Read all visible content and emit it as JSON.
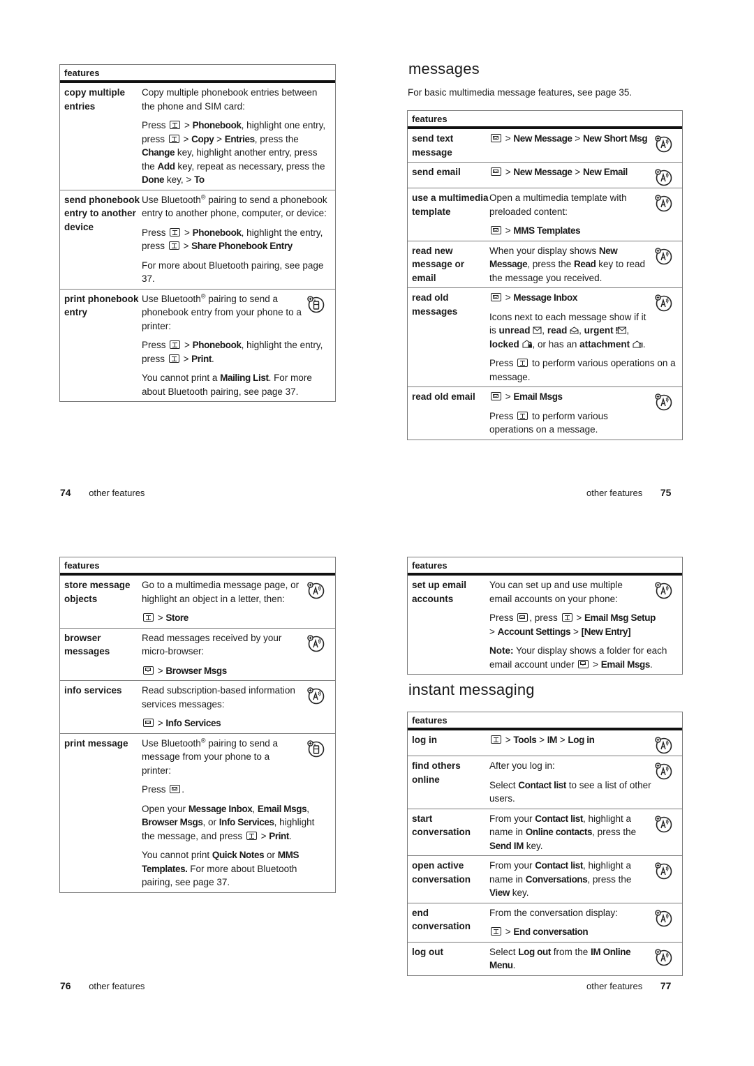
{
  "page74": {
    "table_header": "features",
    "rows": [
      {
        "name": "copy multiple entries",
        "intro": "Copy multiple phonebook entries between the phone and SIM card:",
        "steps": {
          "press": "Press",
          "phonebook": "Phonebook",
          "hl_one": ", highlight one entry,",
          "press2": "press",
          "copy": "Copy",
          "entries": "Entries",
          "press_the": ", press the",
          "change": "Change",
          "hl_another": "key, highlight another entry, press the",
          "add": "Add",
          "repeat": "key, repeat as necessary, press the",
          "done": "Done",
          "key": "key,",
          "to": "To"
        }
      },
      {
        "name": "send phonebook entry to another device",
        "intro_a": "Use Bluetooth",
        "intro_b": "pairing to send a phonebook entry to another phone, computer, or device:",
        "press": "Press",
        "phonebook": "Phonebook",
        "hl": ", highlight the entry,",
        "press2": "press",
        "share": "Share Phonebook Entry",
        "more": "For more about Bluetooth pairing, see page 37."
      },
      {
        "name": "print phonebook entry",
        "icon": "bluetooth-print-icon",
        "intro_a": "Use Bluetooth",
        "intro_b": "pairing to send a phonebook entry from your phone to a printer:",
        "press": "Press",
        "phonebook": "Phonebook",
        "hl": ", highlight the entry,",
        "press2": "press",
        "print": "Print",
        "cannot": "You cannot print a",
        "mailing": "Mailing List",
        "more": ". For more about Bluetooth pairing, see page 37."
      }
    ],
    "footer": {
      "number": "74",
      "label": "other features"
    }
  },
  "page75": {
    "title": "messages",
    "intro": "For basic multimedia message features, see page 35.",
    "table_header": "features",
    "rows": [
      {
        "name": "send text message",
        "path": [
          "New Message",
          "New Short Msg"
        ],
        "icon": "network-dependent-icon"
      },
      {
        "name": "send email",
        "path": [
          "New Message",
          "New Email"
        ],
        "icon": "network-dependent-icon"
      },
      {
        "name": "use a multimedia template",
        "intro": "Open a multimedia template with preloaded content:",
        "path": [
          "MMS Templates"
        ],
        "icon": "network-dependent-icon"
      },
      {
        "name": "read new message or email",
        "t1": "When your display shows",
        "b1": "New Message",
        "t2": ", press the",
        "b2": "Read",
        "t3": "key to read the message you received.",
        "icon": "network-dependent-icon"
      },
      {
        "name": "read old messages",
        "path": [
          "Message Inbox"
        ],
        "icons_text": {
          "a": "Icons next to each message show if it is",
          "unread": "unread",
          "read": "read",
          "urgent": "urgent",
          "locked": "locked",
          "b": ", or has an",
          "attachment": "attachment"
        },
        "press": "Press",
        "press_rest": "to perform various operations on a message.",
        "icon": "network-dependent-icon"
      },
      {
        "name": "read old email",
        "path": [
          "Email Msgs"
        ],
        "press": "Press",
        "press_rest": "to perform various operations on a message.",
        "icon": "network-dependent-icon"
      }
    ],
    "footer": {
      "number": "75",
      "label": "other features"
    }
  },
  "page76": {
    "table_header": "features",
    "rows": [
      {
        "name": "store message objects",
        "intro": "Go to a multimedia message page, or highlight an object in a letter, then:",
        "path": [
          "Store"
        ],
        "icon": "network-dependent-icon"
      },
      {
        "name": "browser messages",
        "intro": "Read messages received by your micro-browser:",
        "path": [
          "Browser Msgs"
        ],
        "icon": "network-dependent-icon"
      },
      {
        "name": "info services",
        "intro": "Read subscription-based information services messages:",
        "path": [
          "Info Services"
        ],
        "icon": "network-dependent-icon"
      },
      {
        "name": "print message",
        "icon": "bluetooth-print-icon",
        "intro_a": "Use Bluetooth",
        "intro_b": "pairing to send a message from your phone to a printer:",
        "press": "Press",
        "open": "Open your",
        "inbox": "Message Inbox",
        "email": "Email Msgs",
        "browser": "Browser Msgs",
        "or": ", or",
        "info": "Info Services",
        "hl": ", highlight the message, and press",
        "print": "Print",
        "cannot": "You cannot print",
        "quick": "Quick Notes",
        "or2": "or",
        "mms": "MMS Templates.",
        "more": "For more about Bluetooth pairing, see page 37."
      }
    ],
    "footer": {
      "number": "76",
      "label": "other features"
    }
  },
  "page77": {
    "table1_header": "features",
    "rows1": [
      {
        "name": "set up email accounts",
        "intro": "You can set up and use multiple email accounts on your phone:",
        "press": "Press",
        "press2": ", press",
        "setup": "Email Msg Setup",
        "account": "Account Settings",
        "newentry": "[New Entry]",
        "note_label": "Note:",
        "note": "Your display shows a folder for each email account under",
        "emailmsgs": "Email Msgs",
        "icon": "network-dependent-icon"
      }
    ],
    "title": "instant messaging",
    "table2_header": "features",
    "rows2": [
      {
        "name": "log in",
        "path": [
          "Tools",
          "IM",
          "Log in"
        ],
        "icon": "network-dependent-icon"
      },
      {
        "name": "find others online",
        "intro": "After you log in:",
        "select": "Select",
        "contact": "Contact list",
        "rest": "to see a list of other users.",
        "icon": "network-dependent-icon"
      },
      {
        "name": "start conversation",
        "a": "From your",
        "contact": "Contact list",
        "b": ", highlight a name in",
        "c": "Online contacts",
        "d": ", press the",
        "e": "Send IM",
        "f": "key.",
        "icon": "network-dependent-icon"
      },
      {
        "name": "open active conversation",
        "a": "From your",
        "contact": "Contact list",
        "b": ", highlight a name in",
        "c": "Conversations",
        "d": ", press the",
        "e": "View",
        "f": "key.",
        "icon": "network-dependent-icon"
      },
      {
        "name": "end conversation",
        "intro": "From the conversation display:",
        "path": [
          "End conversation"
        ],
        "icon": "network-dependent-icon"
      },
      {
        "name": "log out",
        "a": "Select",
        "b": "Log out",
        "c": "from the",
        "d": "IM Online Menu",
        "e": ".",
        "icon": "network-dependent-icon"
      }
    ],
    "footer": {
      "number": "77",
      "label": "other features"
    }
  }
}
